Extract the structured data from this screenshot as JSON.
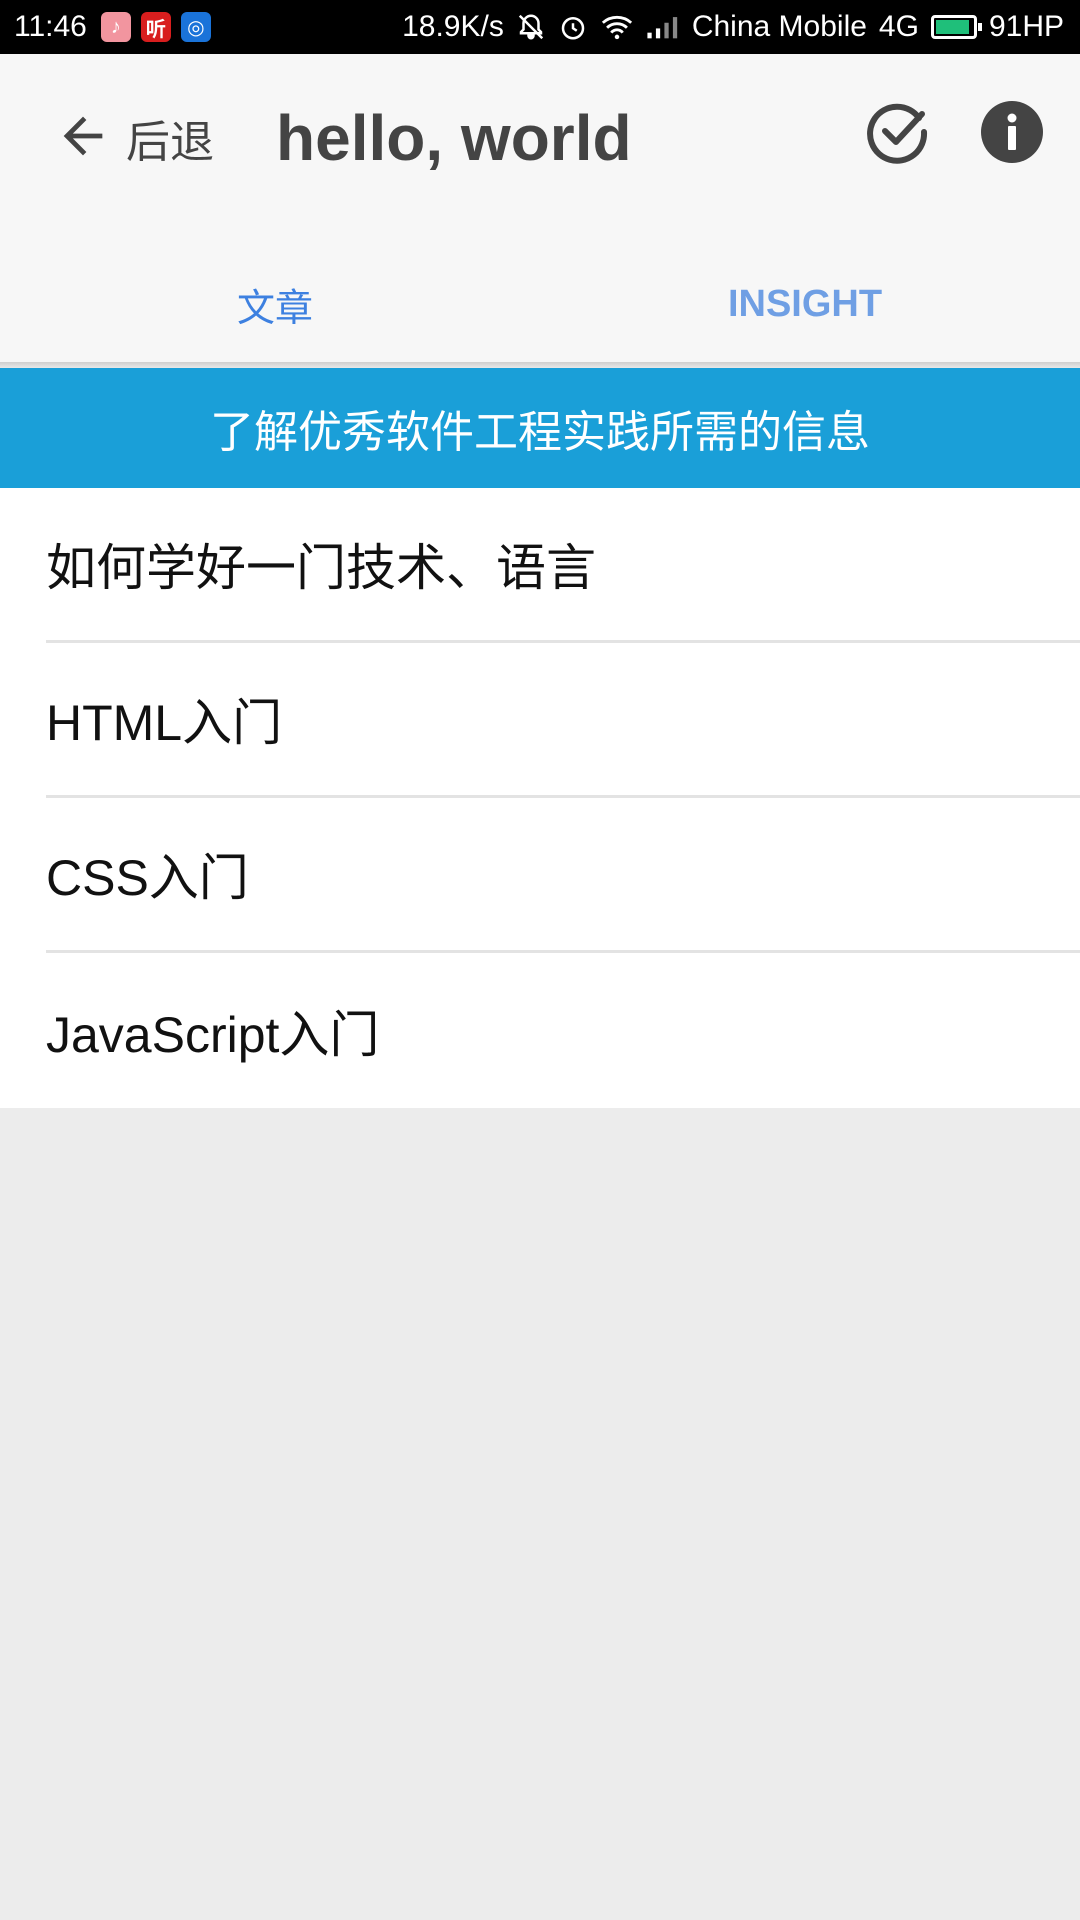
{
  "status_bar": {
    "time": "11:46",
    "speed": "18.9K/s",
    "carrier": "China Mobile",
    "network": "4G",
    "battery_label": "91HP",
    "battery_level": 0.91,
    "app_icons": [
      {
        "name": "music-app-icon",
        "glyph": "♪",
        "color": "#f2959f"
      },
      {
        "name": "ting-app-icon",
        "glyph": "听",
        "color": "#d81e1e"
      },
      {
        "name": "chat-app-icon",
        "glyph": "◎",
        "color": "#1a73d9"
      }
    ]
  },
  "header": {
    "back_label": "后退",
    "title": "hello, world",
    "icons": {
      "back": "arrow-left-icon",
      "check": "check-circle-icon",
      "info": "info-icon"
    }
  },
  "tabs": [
    {
      "label": "文章",
      "active": true
    },
    {
      "label": "INSIGHT",
      "active": false
    }
  ],
  "colors": {
    "accent": "#3d80e0",
    "banner": "#1a9fd8",
    "background": "#ececec"
  },
  "banner": {
    "text": "了解优秀软件工程实践所需的信息"
  },
  "articles": [
    {
      "title": "如何学好一门技术、语言"
    },
    {
      "title": "HTML入门"
    },
    {
      "title": "CSS入门"
    },
    {
      "title": "JavaScript入门"
    }
  ]
}
